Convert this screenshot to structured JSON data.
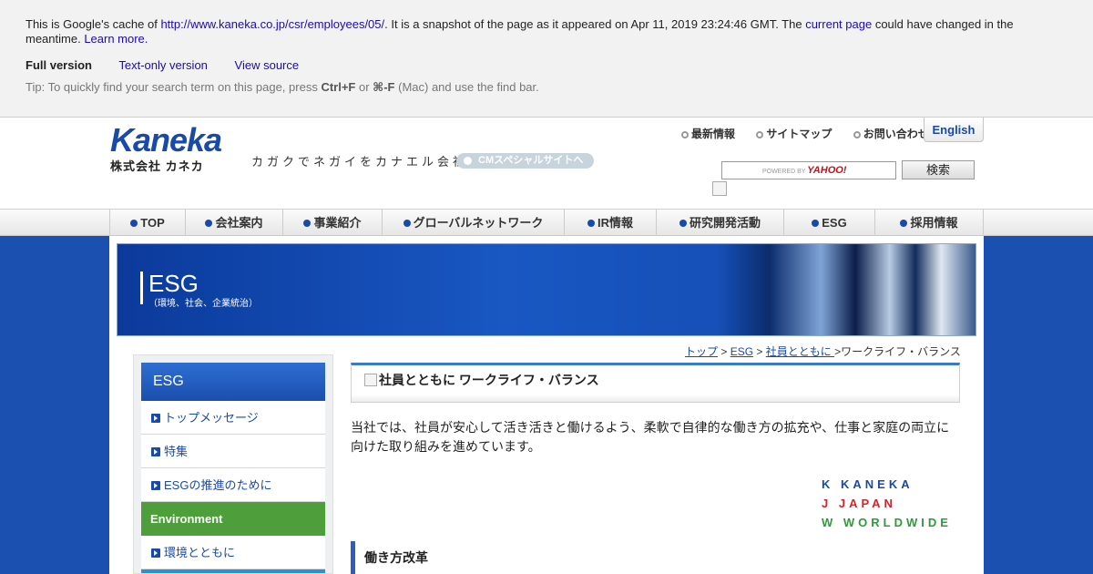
{
  "cache_banner": {
    "text_before": "This is Google's cache of ",
    "url": "http://www.kaneka.co.jp/csr/employees/05/",
    "text_after": ". It is a snapshot of the page as it appeared on Apr 11, 2019 23:24:46 GMT. The ",
    "current_page": "current page",
    "text_end": " could have changed in the meantime. ",
    "learn_more": "Learn more.",
    "full_version": "Full version",
    "text_only": "Text-only version",
    "view_source": "View source",
    "tip_before": "Tip: To quickly find your search term on this page, press ",
    "tip_key1": "Ctrl+F",
    "tip_or": " or ",
    "tip_key2": "⌘-F",
    "tip_after": " (Mac) and use the find bar."
  },
  "header": {
    "logo_word": "Kaneka",
    "logo_sub": "株式会社 カネカ",
    "tagline": "カガクでネガイをカナエル会社",
    "cm_link": "CMスペシャルサイトへ",
    "util_links": [
      "最新情報",
      "サイトマップ",
      "お問い合わせ"
    ],
    "english": "English",
    "search_powered": "POWERED BY",
    "search_yahoo": "YAHOO!",
    "search_button": "検索"
  },
  "nav": {
    "items": [
      "TOP",
      "会社案内",
      "事業紹介",
      "グローバルネットワーク",
      "IR情報",
      "研究開発活動",
      "ESG",
      "採用情報"
    ]
  },
  "banner": {
    "title": "ESG",
    "subtitle": "（環境、社会、企業統治）"
  },
  "sidebar": {
    "head": "ESG",
    "items": [
      "トップメッセージ",
      "特集",
      "ESGの推進のために"
    ],
    "env_label": "Environment",
    "env_item": "環境とともに"
  },
  "breadcrumb": {
    "top": "トップ",
    "sep": " > ",
    "esg": "ESG",
    "employees": "社員とともに ",
    "current": ">ワークライフ・バランス"
  },
  "main": {
    "title_alt": "社員とともに",
    "title": " ワークライフ・バランス",
    "lead": "当社では、社員が安心して活き活きと働けるよう、柔軟で自律的な働き方の拡充や、仕事と家庭の両立に向けた取り組みを進めています。",
    "kjw": [
      "K KANEKA",
      "J JAPAN",
      "W WORLDWIDE"
    ],
    "section": "働き方改革"
  }
}
